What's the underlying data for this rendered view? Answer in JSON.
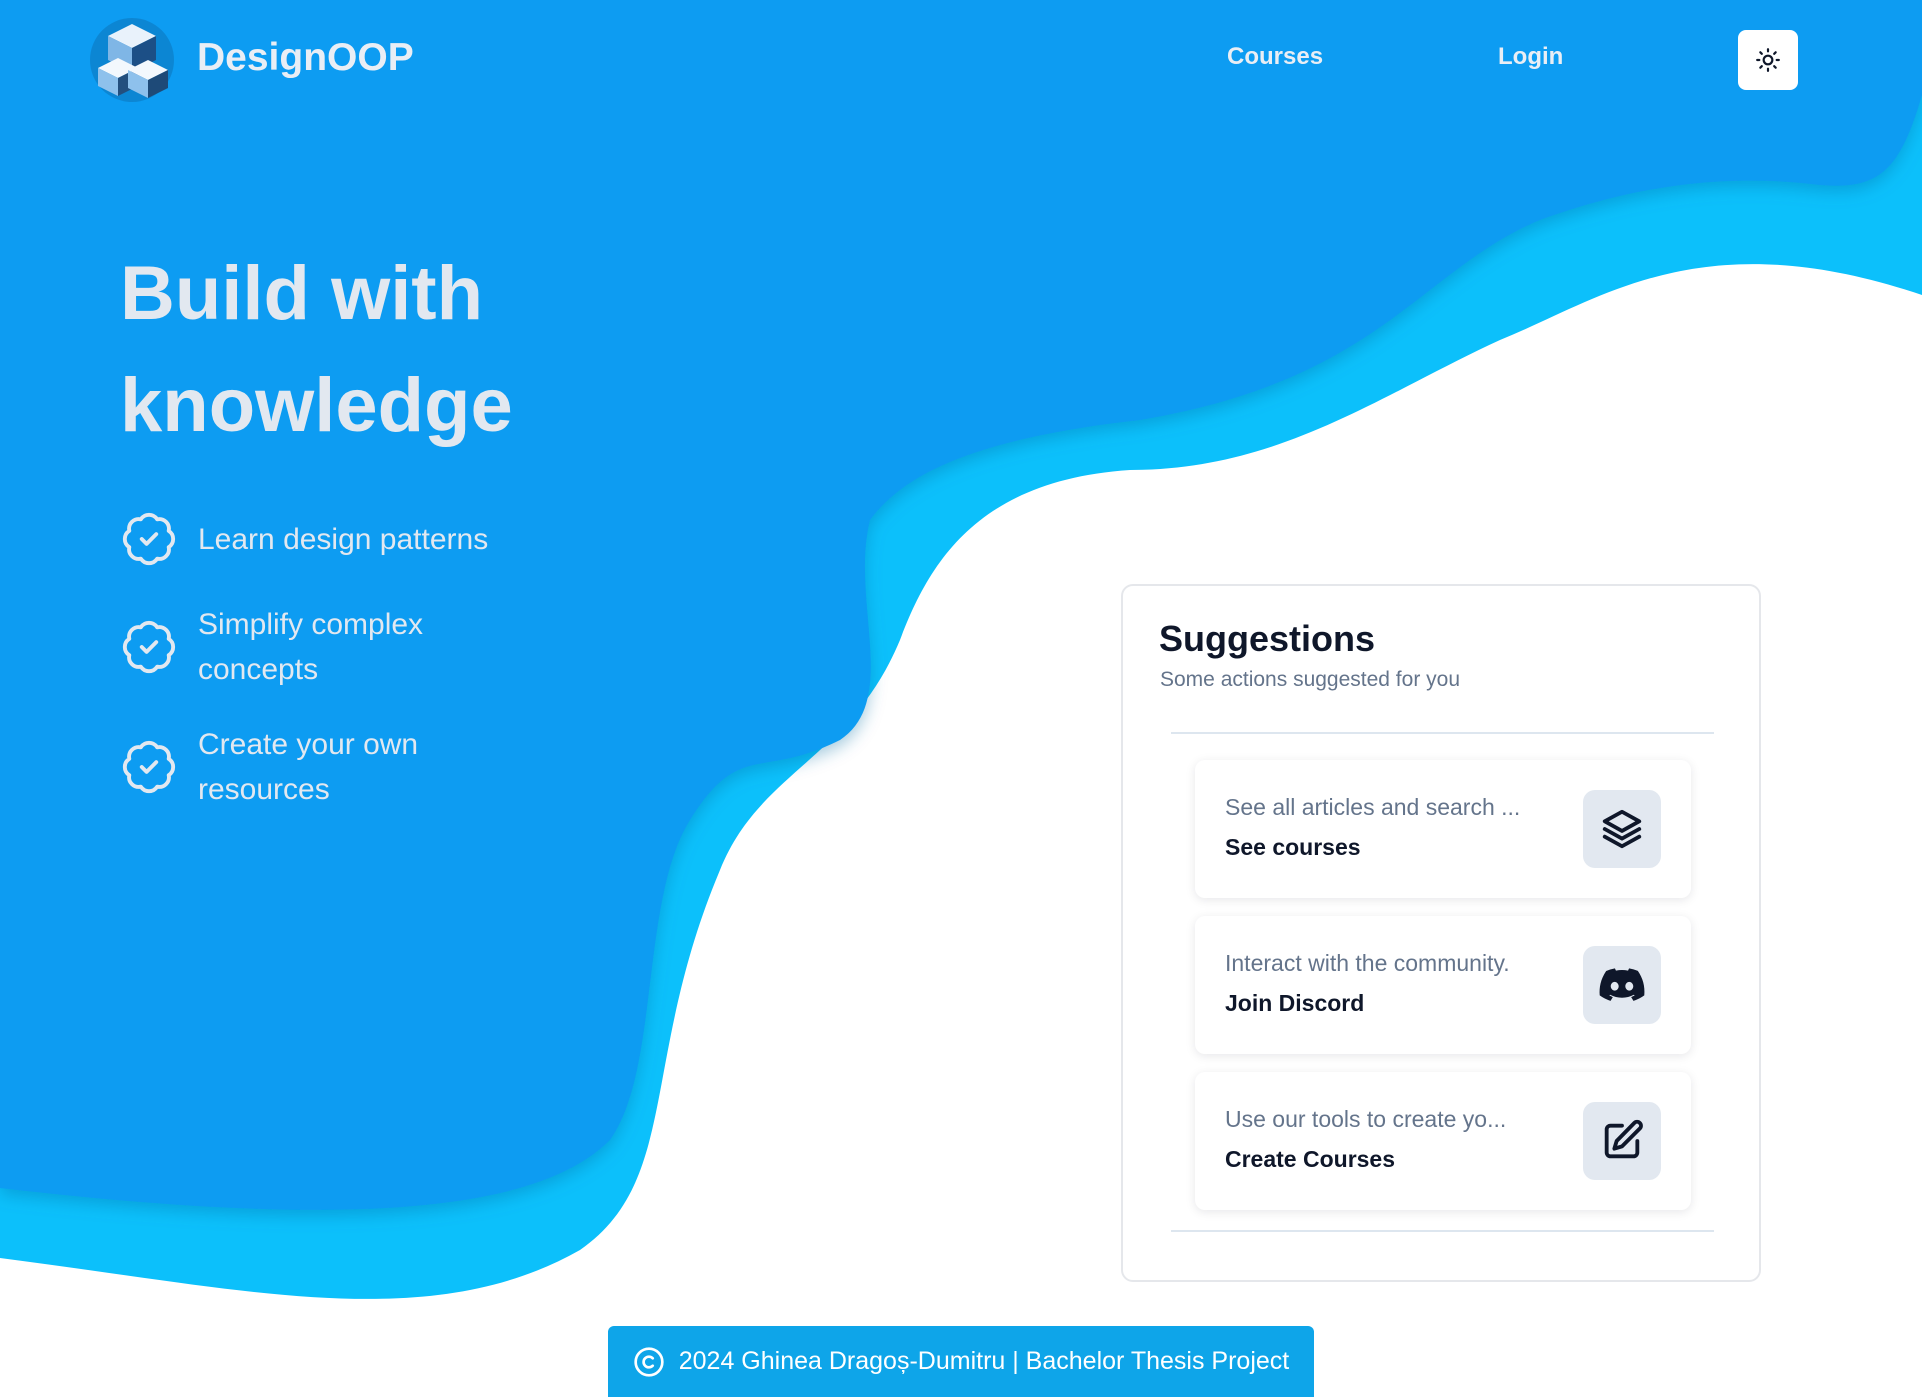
{
  "nav": {
    "brand": "DesignOOP",
    "links": [
      "Courses",
      "Login"
    ],
    "logo_icon": "cubes-logo",
    "theme_icon": "sun-icon"
  },
  "hero": {
    "title_line1": "Build with",
    "title_line2": "knowledge",
    "features": [
      {
        "icon": "badge-check-icon",
        "text": "Learn design patterns"
      },
      {
        "icon": "badge-check-icon",
        "text": "Simplify complex concepts"
      },
      {
        "icon": "badge-check-icon",
        "text": "Create your own resources"
      }
    ]
  },
  "suggestions": {
    "title": "Suggestions",
    "subtitle": "Some actions suggested for you",
    "items": [
      {
        "description": "See all articles and search ...",
        "action": "See courses",
        "icon": "layers-icon"
      },
      {
        "description": "Interact with the community.",
        "action": "Join Discord",
        "icon": "discord-icon"
      },
      {
        "description": "Use our tools to create yo...",
        "action": "Create Courses",
        "icon": "edit-icon"
      }
    ]
  },
  "footer": {
    "icon": "copyright-icon",
    "text": "2024 Ghinea Dragoș-Dumitru | Bachelor Thesis Project"
  },
  "colors": {
    "primary_blue": "#0ea5e9",
    "deep_blue": "#0b9cf2",
    "cyan": "#0cc0fb",
    "hero_text": "#e2e8f0"
  }
}
